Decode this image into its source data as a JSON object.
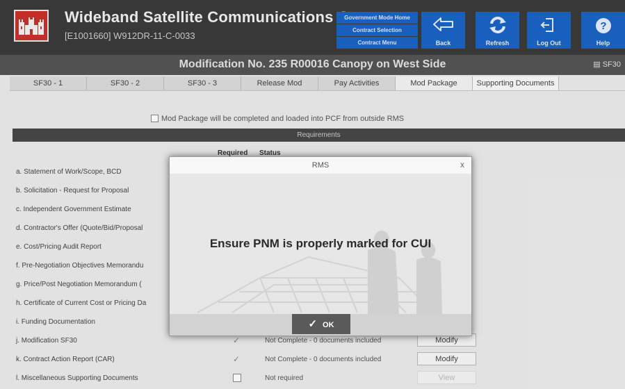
{
  "header": {
    "title": "Wideband Satellite Communications Center",
    "subtitle": "[E1001660] W912DR-11-C-0033",
    "gov_menu": [
      "Government Mode Home",
      "Contract Selection",
      "Contract Menu"
    ],
    "toolbar": [
      {
        "label": "Back",
        "icon": "back-arrow-icon"
      },
      {
        "label": "Refresh",
        "icon": "refresh-icon"
      },
      {
        "label": "Log Out",
        "icon": "logout-icon"
      },
      {
        "label": "Help",
        "icon": "help-icon"
      }
    ]
  },
  "title_bar": {
    "title": "Modification No. 235 R00016 Canopy on West Side",
    "right_label": "SF30"
  },
  "tabs": [
    "SF30 - 1",
    "SF30 - 2",
    "SF30 - 3",
    "Release Mod",
    "Pay Activities",
    "Mod Package",
    "Supporting Documents"
  ],
  "active_tab": "Mod Package",
  "mod_package": {
    "pcf_label": "Mod Package will be completed and loaded into PCF from outside RMS",
    "requirements_header": "Requirements",
    "col_required": "Required",
    "col_status": "Status",
    "rows": [
      {
        "label": "a. Statement of Work/Scope, BCD",
        "required": "",
        "status": "",
        "button": ""
      },
      {
        "label": "b. Solicitation - Request for Proposal",
        "required": "",
        "status": "",
        "button": ""
      },
      {
        "label": "c. Independent Government Estimate",
        "required": "",
        "status": "",
        "button": ""
      },
      {
        "label": "d. Contractor's Offer (Quote/Bid/Proposal",
        "required": "",
        "status": "",
        "button": ""
      },
      {
        "label": "e. Cost/Pricing Audit Report",
        "required": "",
        "status": "",
        "button": ""
      },
      {
        "label": "f. Pre-Negotiation Objectives Memorandu",
        "required": "",
        "status": "",
        "button": ""
      },
      {
        "label": "g. Price/Post Negotiation Memorandum (",
        "required": "",
        "status": "",
        "button": ""
      },
      {
        "label": "h. Certificate of Current Cost or Pricing Da",
        "required": "",
        "status": "",
        "button": ""
      },
      {
        "label": "i. Funding Documentation",
        "required": "",
        "status": "",
        "button": ""
      },
      {
        "label": "j. Modification SF30",
        "required": "✓",
        "status": "Not Complete - 0 documents included",
        "button": "Modify"
      },
      {
        "label": "k. Contract Action Report (CAR)",
        "required": "✓",
        "status": "Not Complete - 0 documents included",
        "button": "Modify"
      },
      {
        "label": "l. Miscellaneous Supporting Documents",
        "required": "",
        "status": "Not required",
        "button": "View"
      }
    ]
  },
  "modal": {
    "title": "RMS",
    "close": "x",
    "message": "Ensure PNM is properly marked for CUI",
    "ok_label": "OK"
  },
  "colors": {
    "header_bg": "#3b3b3b",
    "accent_blue": "#1a63c6",
    "logo_red": "#c8312a"
  }
}
